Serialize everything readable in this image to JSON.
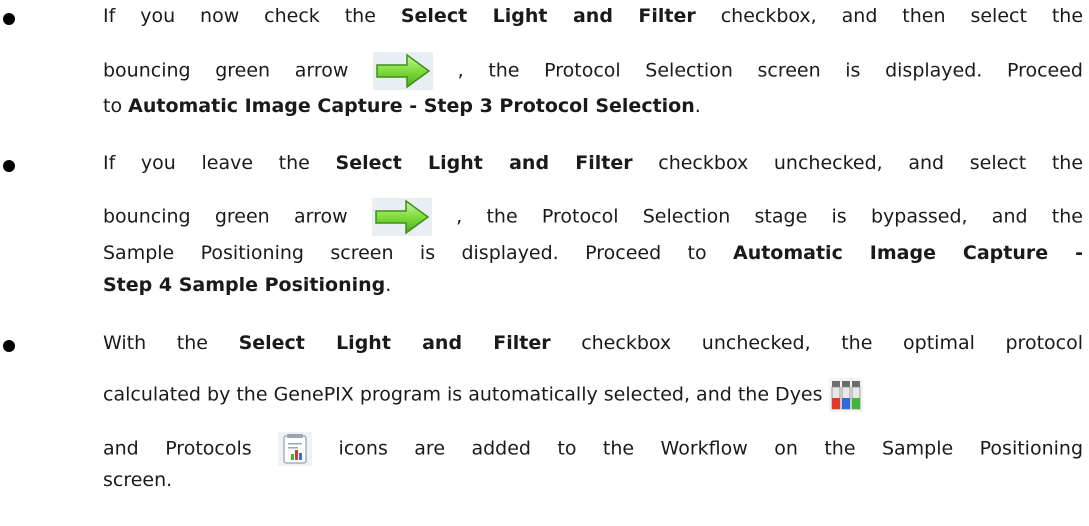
{
  "bullets": [
    {
      "l1_a": "If you now check the ",
      "l1_b": "Select Light and Filter",
      "l1_c": " checkbox, and then select the",
      "l2_a": "bouncing green arrow ",
      "arrow_icon": "green-arrow-icon",
      "l2_b": " , the Protocol Selection screen is displayed. Proceed",
      "l3_a": "to ",
      "l3_b": "Automatic Image Capture - Step 3  Protocol Selection",
      "l3_c": "."
    },
    {
      "l1_a": "If you leave the ",
      "l1_b": "Select Light and Filter",
      "l1_c": " checkbox unchecked, and select the",
      "l2_a": "bouncing green arrow ",
      "arrow_icon": "green-arrow-icon",
      "l2_b": " , the Protocol Selection stage is bypassed, and the",
      "l3_a": "Sample Positioning screen is displayed. Proceed to ",
      "l3_b": "Automatic Image Capture -",
      "l4_b": "Step 4  Sample Positioning",
      "l4_c": "."
    },
    {
      "l1_a": "With the ",
      "l1_b": "Select Light and Filter",
      "l1_c": " checkbox unchecked, the optimal protocol",
      "l2_a": "calculated by the GenePIX program is automatically selected, and the Dyes ",
      "dyes_icon": "dyes-icon",
      "l3_a": "and Protocols ",
      "protocols_icon": "protocols-icon",
      "l3_b": " icons are added to the Workflow on the Sample Positioning",
      "l4_a": "screen."
    }
  ]
}
